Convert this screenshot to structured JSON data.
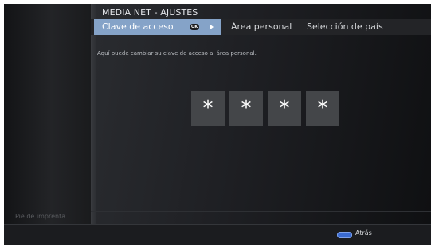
{
  "window": {
    "title": "MEDIA NET - AJUSTES"
  },
  "menu": {
    "tabs": [
      {
        "label": "Clave de acceso",
        "active": true,
        "icon": "ok-icon",
        "ok_text": "OK"
      },
      {
        "label": "Área personal",
        "active": false
      },
      {
        "label": "Selección de país",
        "active": false
      }
    ]
  },
  "main": {
    "description": "Aquí puede cambiar su clave de acceso al área personal.",
    "pin_digits": [
      "*",
      "*",
      "*",
      "*"
    ]
  },
  "sidebar": {
    "imprint_label": "Pie de imprenta"
  },
  "footer": {
    "back_label": "Atrás",
    "back_icon": "blue-button-icon"
  },
  "colors": {
    "accent": "#85a3c8",
    "blue_button": "#3a6ad0",
    "background": "#16171a",
    "pin_box": "#444649"
  }
}
